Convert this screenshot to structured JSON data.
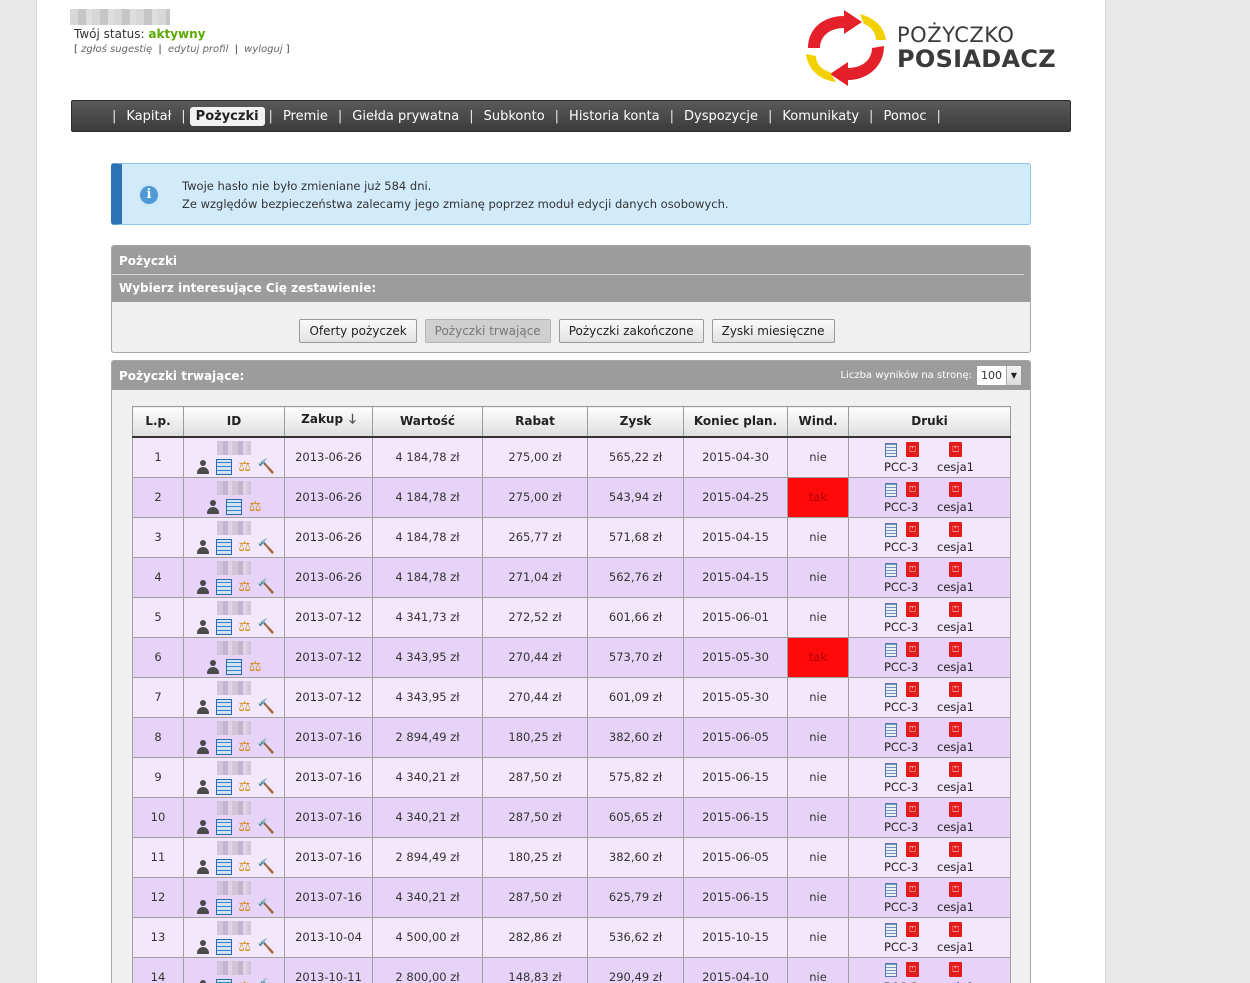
{
  "header": {
    "status_label": "Twój status:",
    "status_value": "aktywny",
    "links": [
      "zgłoś sugestię",
      "edytuj profil",
      "wyloguj"
    ],
    "logo_line1": "POŻYCZKO",
    "logo_line2": "POSIADACZ"
  },
  "nav": {
    "items": [
      "Kapitał",
      "Pożyczki",
      "Premie",
      "Giełda prywatna",
      "Subkonto",
      "Historia konta",
      "Dyspozycje",
      "Komunikaty",
      "Pomoc"
    ],
    "active": "Pożyczki"
  },
  "info": {
    "line1": "Twoje hasło nie było zmieniane już 584 dni.",
    "line2": "Ze względów bezpieczeństwa zalecamy jego zmianę poprzez moduł edycji danych osobowych."
  },
  "panel": {
    "title": "Pożyczki",
    "subtitle": "Wybierz interesujące Cię zestawienie:",
    "buttons": [
      "Oferty pożyczek",
      "Pożyczki trwające",
      "Pożyczki zakończone",
      "Zyski miesięczne"
    ],
    "disabled_button": "Pożyczki trwające"
  },
  "table_panel": {
    "title": "Pożyczki trwające:",
    "per_page_label": "Liczba wyników na stronę:",
    "per_page_value": "100"
  },
  "table": {
    "columns": [
      "L.p.",
      "ID",
      "Zakup",
      "Wartość",
      "Rabat",
      "Zysk",
      "Koniec plan.",
      "Wind.",
      "Druki"
    ],
    "doc_labels": [
      "PCC-3",
      "cesja1"
    ],
    "rows": [
      {
        "lp": "1",
        "zakup": "2013-06-26",
        "wartosc": "4 184,78 zł",
        "rabat": "275,00 zł",
        "zysk": "565,22 zł",
        "koniec": "2015-04-30",
        "wind": "nie",
        "gavel": true
      },
      {
        "lp": "2",
        "zakup": "2013-06-26",
        "wartosc": "4 184,78 zł",
        "rabat": "275,00 zł",
        "zysk": "543,94 zł",
        "koniec": "2015-04-25",
        "wind": "tak",
        "gavel": false
      },
      {
        "lp": "3",
        "zakup": "2013-06-26",
        "wartosc": "4 184,78 zł",
        "rabat": "265,77 zł",
        "zysk": "571,68 zł",
        "koniec": "2015-04-15",
        "wind": "nie",
        "gavel": true
      },
      {
        "lp": "4",
        "zakup": "2013-06-26",
        "wartosc": "4 184,78 zł",
        "rabat": "271,04 zł",
        "zysk": "562,76 zł",
        "koniec": "2015-04-15",
        "wind": "nie",
        "gavel": true
      },
      {
        "lp": "5",
        "zakup": "2013-07-12",
        "wartosc": "4 341,73 zł",
        "rabat": "272,52 zł",
        "zysk": "601,66 zł",
        "koniec": "2015-06-01",
        "wind": "nie",
        "gavel": true
      },
      {
        "lp": "6",
        "zakup": "2013-07-12",
        "wartosc": "4 343,95 zł",
        "rabat": "270,44 zł",
        "zysk": "573,70 zł",
        "koniec": "2015-05-30",
        "wind": "tak",
        "gavel": false
      },
      {
        "lp": "7",
        "zakup": "2013-07-12",
        "wartosc": "4 343,95 zł",
        "rabat": "270,44 zł",
        "zysk": "601,09 zł",
        "koniec": "2015-05-30",
        "wind": "nie",
        "gavel": true
      },
      {
        "lp": "8",
        "zakup": "2013-07-16",
        "wartosc": "2 894,49 zł",
        "rabat": "180,25 zł",
        "zysk": "382,60 zł",
        "koniec": "2015-06-05",
        "wind": "nie",
        "gavel": true
      },
      {
        "lp": "9",
        "zakup": "2013-07-16",
        "wartosc": "4 340,21 zł",
        "rabat": "287,50 zł",
        "zysk": "575,82 zł",
        "koniec": "2015-06-15",
        "wind": "nie",
        "gavel": true
      },
      {
        "lp": "10",
        "zakup": "2013-07-16",
        "wartosc": "4 340,21 zł",
        "rabat": "287,50 zł",
        "zysk": "605,65 zł",
        "koniec": "2015-06-15",
        "wind": "nie",
        "gavel": true
      },
      {
        "lp": "11",
        "zakup": "2013-07-16",
        "wartosc": "2 894,49 zł",
        "rabat": "180,25 zł",
        "zysk": "382,60 zł",
        "koniec": "2015-06-05",
        "wind": "nie",
        "gavel": true
      },
      {
        "lp": "12",
        "zakup": "2013-07-16",
        "wartosc": "4 340,21 zł",
        "rabat": "287,50 zł",
        "zysk": "625,79 zł",
        "koniec": "2015-06-15",
        "wind": "nie",
        "gavel": true
      },
      {
        "lp": "13",
        "zakup": "2013-10-04",
        "wartosc": "4 500,00 zł",
        "rabat": "282,86 zł",
        "zysk": "536,62 zł",
        "koniec": "2015-10-15",
        "wind": "nie",
        "gavel": true
      },
      {
        "lp": "14",
        "zakup": "2013-10-11",
        "wartosc": "2 800,00 zł",
        "rabat": "148,83 zł",
        "zysk": "290,49 zł",
        "koniec": "2015-04-10",
        "wind": "nie",
        "gavel": true
      }
    ]
  },
  "icons": {
    "info": "info-icon",
    "sort": "sort-desc-arrow-icon",
    "id_icons": [
      "borrower-icon",
      "schedule-icon",
      "scale-icon",
      "gavel-icon"
    ],
    "docs": [
      "document-icon",
      "pdf-icon",
      "pdf-icon"
    ]
  },
  "colors": {
    "status_active": "#5aa800",
    "row_odd": "#f3e8fb",
    "row_even": "#e7d3f8",
    "wind_tak": "#ff0a0a",
    "info_border": "#2a74b5"
  }
}
